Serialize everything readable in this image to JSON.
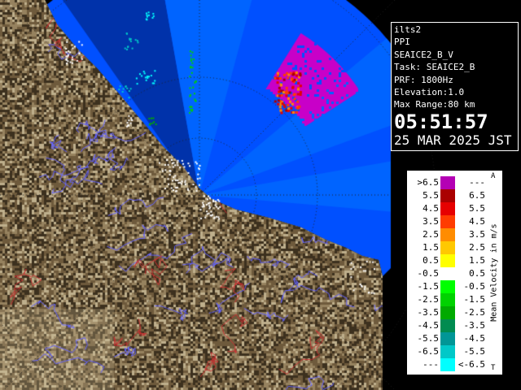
{
  "info": {
    "station": "ilts2",
    "product": "PPI",
    "config": "SEAICE2_B_V",
    "task": "Task: SEAICE2_B",
    "prf": "PRF: 1800Hz",
    "elevation": "Elevation:1.0",
    "max_range": "Max Range:80 km",
    "time": "05:51:57",
    "date": "25 MAR 2025 JST"
  },
  "legend": {
    "title": "Mean Velocity in m/s",
    "top_mark": "A",
    "bottom_mark": "T",
    "rows": [
      {
        "left": ">6.5",
        "right": "---",
        "color": "#b400b4"
      },
      {
        "left": "5.5",
        "right": "6.5",
        "color": "#aa0000"
      },
      {
        "left": "4.5",
        "right": "5.5",
        "color": "#e60000"
      },
      {
        "left": "3.5",
        "right": "4.5",
        "color": "#ff3c00"
      },
      {
        "left": "2.5",
        "right": "3.5",
        "color": "#ff8c00"
      },
      {
        "left": "1.5",
        "right": "2.5",
        "color": "#ffc800"
      },
      {
        "left": "0.5",
        "right": "1.5",
        "color": "#ffff00"
      },
      {
        "left": "-0.5",
        "right": "0.5",
        "color": "#ffffff"
      },
      {
        "left": "-1.5",
        "right": "-0.5",
        "color": "#00ff00"
      },
      {
        "left": "-2.5",
        "right": "-1.5",
        "color": "#00d200"
      },
      {
        "left": "-3.5",
        "right": "-2.5",
        "color": "#00aa00"
      },
      {
        "left": "-4.5",
        "right": "-3.5",
        "color": "#008c50"
      },
      {
        "left": "-5.5",
        "right": "-4.5",
        "color": "#009696"
      },
      {
        "left": "-6.5",
        "right": "-5.5",
        "color": "#00c8c8"
      },
      {
        "left": "---",
        "right": "<-6.5",
        "color": "#00ffff"
      }
    ]
  },
  "colors": {
    "sea_background": "#0050ff",
    "scan_sector": "#0064ff",
    "land_base": "#6e5a3c",
    "rivers": "#6464ff",
    "boundaries": "#c83232",
    "magenta_echo": "#c800c8"
  }
}
